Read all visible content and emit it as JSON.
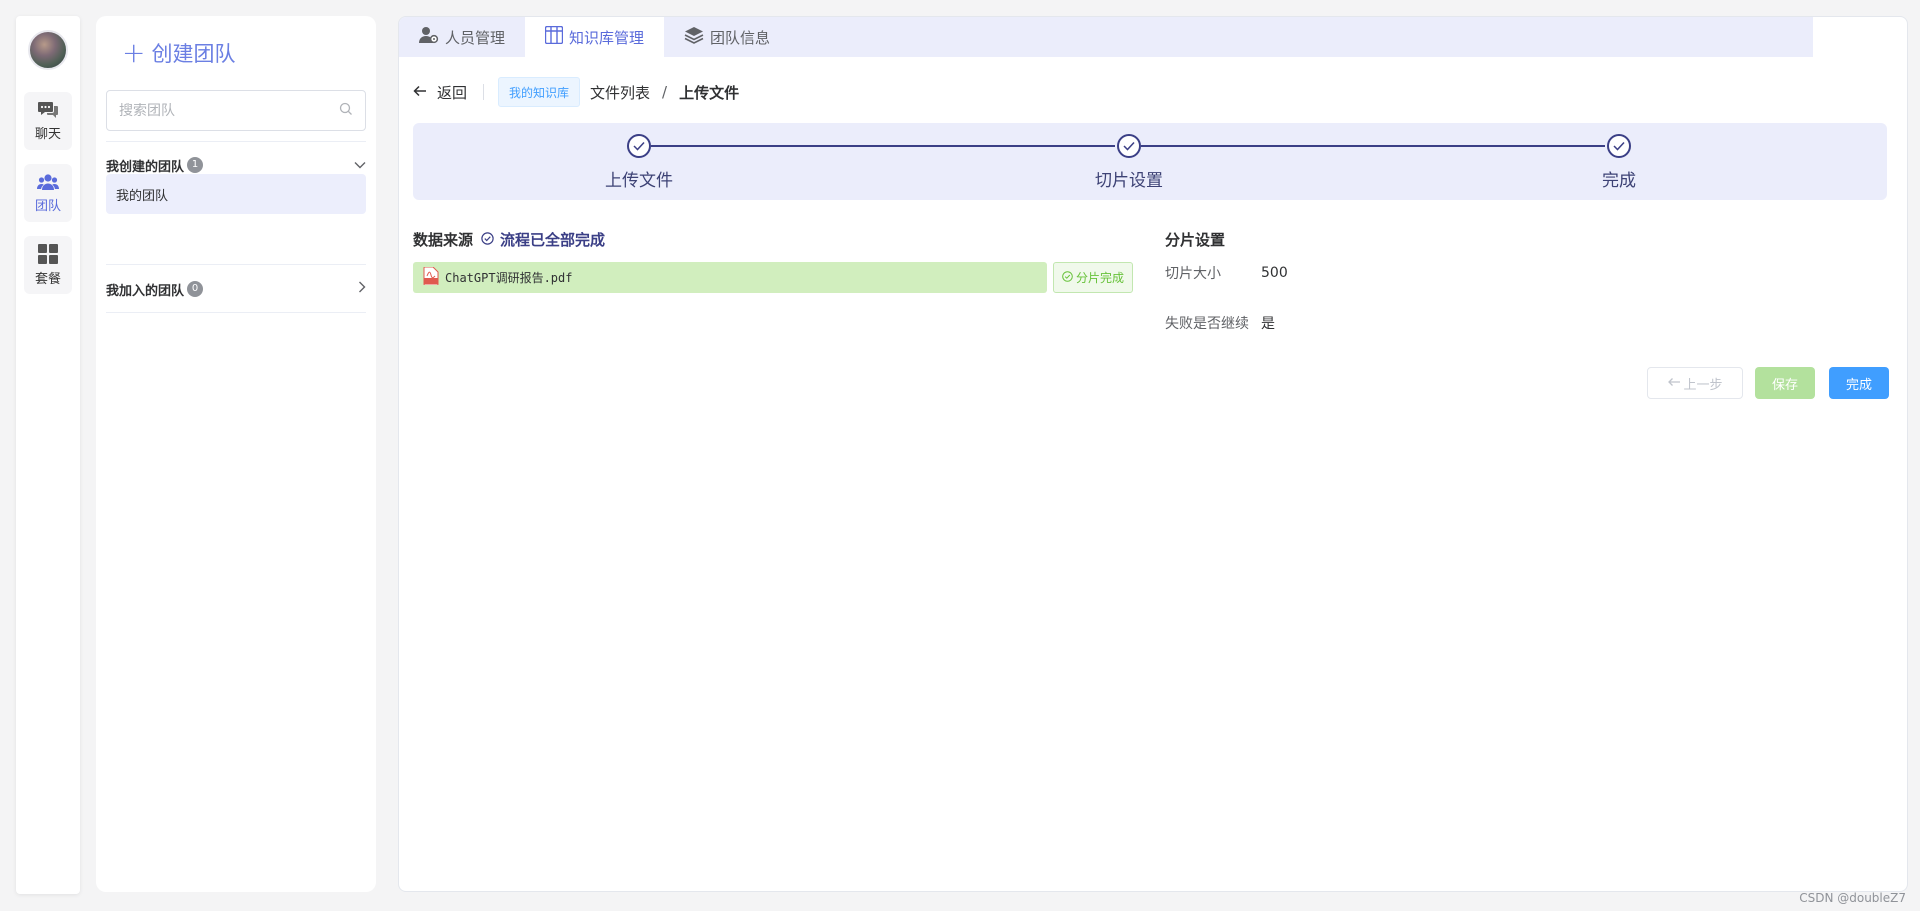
{
  "nav": {
    "items": [
      {
        "label": "聊天",
        "icon": "chat-icon"
      },
      {
        "label": "团队",
        "icon": "team-icon"
      },
      {
        "label": "套餐",
        "icon": "grid-icon"
      }
    ]
  },
  "team_panel": {
    "create_label": "创建团队",
    "search_placeholder": "搜索团队",
    "created_group": {
      "label": "我创建的团队",
      "count": "1"
    },
    "created_teams": [
      "我的团队"
    ],
    "joined_group": {
      "label": "我加入的团队",
      "count": "0"
    }
  },
  "tabs": [
    {
      "label": "人员管理",
      "icon": "user-settings-icon",
      "active": false
    },
    {
      "label": "知识库管理",
      "icon": "library-icon",
      "active": true
    },
    {
      "label": "团队信息",
      "icon": "layers-icon",
      "active": false
    }
  ],
  "topbar": {
    "back_label": "返回",
    "kb_tag": "我的知识库",
    "breadcrumb": [
      "文件列表",
      "/",
      "上传文件"
    ]
  },
  "steps": [
    {
      "label": "上传文件",
      "status": "done"
    },
    {
      "label": "切片设置",
      "status": "done"
    },
    {
      "label": "完成",
      "status": "done"
    }
  ],
  "data_source": {
    "title": "数据来源",
    "status_text": "流程已全部完成",
    "files": [
      {
        "name": "ChatGPT调研报告.pdf",
        "status": "分片完成"
      }
    ]
  },
  "slice_settings": {
    "title": "分片设置",
    "rows": [
      {
        "key": "切片大小",
        "value": "500"
      },
      {
        "key": "失败是否继续",
        "value": "是"
      }
    ]
  },
  "actions": {
    "prev_label": "上一步",
    "save_label": "保存",
    "done_label": "完成"
  },
  "watermark": "CSDN @doubleZ7",
  "colors": {
    "accent": "#5a6bdb",
    "step_dark": "#3b3f86",
    "primary": "#409eff",
    "success": "#67c23a",
    "file_row_bg": "#d1eebe"
  }
}
